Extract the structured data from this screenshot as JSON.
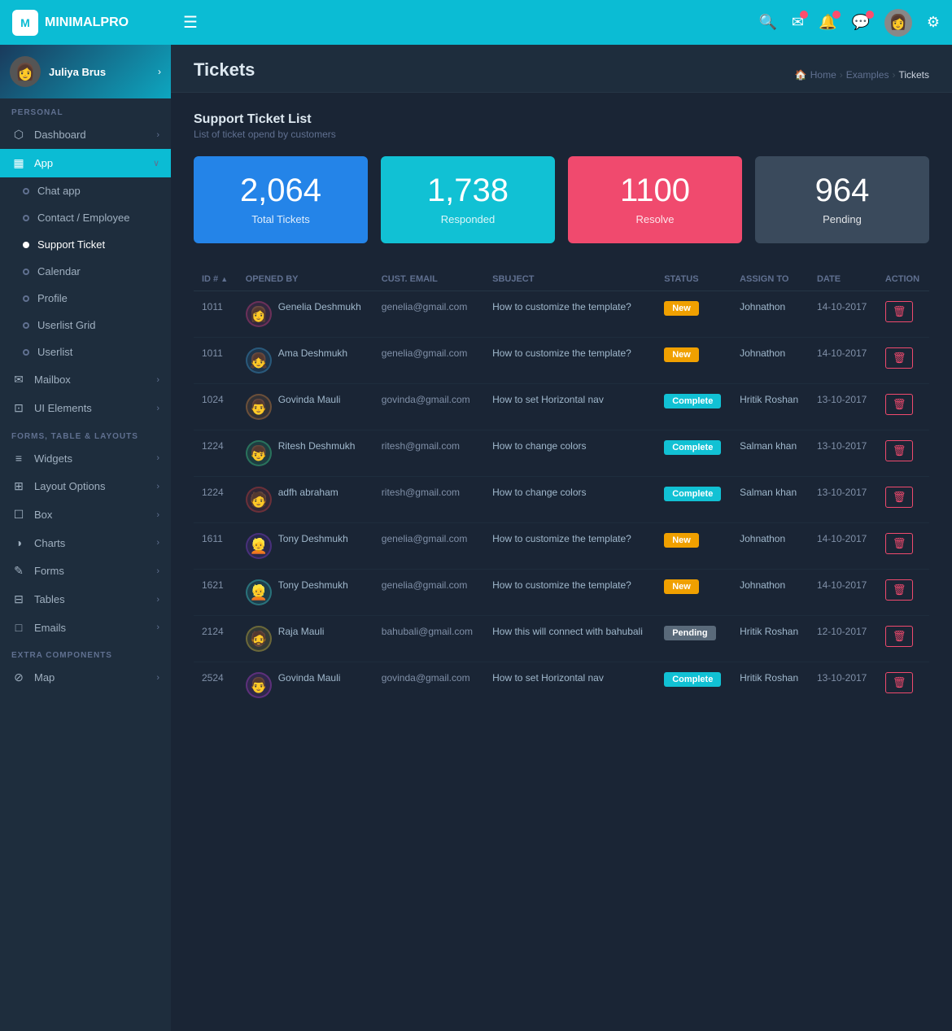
{
  "app": {
    "name": "MINIMALPRO"
  },
  "topnav": {
    "hamburger_label": "☰"
  },
  "user": {
    "name": "Juliya Brus"
  },
  "sidebar": {
    "personal_label": "PERSONAL",
    "forms_label": "FORMS, TABLE & LAYOUTS",
    "extra_label": "EXTRA COMPONENTS",
    "items": [
      {
        "id": "dashboard",
        "label": "Dashboard",
        "icon": "⬡",
        "has_arrow": true
      },
      {
        "id": "app",
        "label": "App",
        "icon": "▦",
        "has_arrow": true,
        "active": true
      },
      {
        "id": "chat-app",
        "label": "Chat app",
        "is_sub": true
      },
      {
        "id": "contact-employee",
        "label": "Contact / Employee",
        "is_sub": true
      },
      {
        "id": "support-ticket",
        "label": "Support Ticket",
        "is_sub": true,
        "active_sub": true
      },
      {
        "id": "calendar",
        "label": "Calendar",
        "is_sub": true
      },
      {
        "id": "profile",
        "label": "Profile",
        "is_sub": true
      },
      {
        "id": "userlist-grid",
        "label": "Userlist Grid",
        "is_sub": true
      },
      {
        "id": "userlist",
        "label": "Userlist",
        "is_sub": true
      },
      {
        "id": "mailbox",
        "label": "Mailbox",
        "icon": "✉",
        "has_arrow": true
      },
      {
        "id": "ui-elements",
        "label": "UI Elements",
        "icon": "⊡",
        "has_arrow": true
      },
      {
        "id": "widgets",
        "label": "Widgets",
        "icon": "≡",
        "has_arrow": true
      },
      {
        "id": "layout-options",
        "label": "Layout Options",
        "icon": "⊞",
        "has_arrow": true
      },
      {
        "id": "box",
        "label": "Box",
        "icon": "☐",
        "has_arrow": true
      },
      {
        "id": "charts",
        "label": "Charts",
        "icon": "◑",
        "has_arrow": true
      },
      {
        "id": "forms",
        "label": "Forms",
        "icon": "✎",
        "has_arrow": true
      },
      {
        "id": "tables",
        "label": "Tables",
        "icon": "⊟",
        "has_arrow": true
      },
      {
        "id": "emails",
        "label": "Emails",
        "icon": "□",
        "has_arrow": true
      },
      {
        "id": "map",
        "label": "Map",
        "icon": "⊘",
        "has_arrow": true
      }
    ]
  },
  "page": {
    "title": "Tickets",
    "breadcrumb": [
      "Home",
      "Examples",
      "Tickets"
    ],
    "section_title": "Support Ticket List",
    "section_sub": "List of ticket opend by customers"
  },
  "stats": [
    {
      "id": "total",
      "number": "2,064",
      "label": "Total Tickets",
      "color": "blue"
    },
    {
      "id": "responded",
      "number": "1,738",
      "label": "Responded",
      "color": "cyan"
    },
    {
      "id": "resolve",
      "number": "1100",
      "label": "Resolve",
      "color": "red"
    },
    {
      "id": "pending",
      "number": "964",
      "label": "Pending",
      "color": "gray"
    }
  ],
  "table": {
    "columns": [
      "ID #",
      "Opened By",
      "Cust. Email",
      "Sbuject",
      "Status",
      "Assign to",
      "Date",
      "Action"
    ],
    "rows": [
      {
        "id": "1011",
        "opened_by": "Genelia Deshmukh",
        "avatar": "👩",
        "email": "genelia@gmail.com",
        "subject": "How to customize the template?",
        "status": "New",
        "assign_to": "Johnathon",
        "date": "14-10-2017"
      },
      {
        "id": "1011",
        "opened_by": "Ama Deshmukh",
        "avatar": "👧",
        "email": "genelia@gmail.com",
        "subject": "How to customize the template?",
        "status": "New",
        "assign_to": "Johnathon",
        "date": "14-10-2017"
      },
      {
        "id": "1024",
        "opened_by": "Govinda Mauli",
        "avatar": "👨",
        "email": "govinda@gmail.com",
        "subject": "How to set Horizontal nav",
        "status": "Complete",
        "assign_to": "Hritik Roshan",
        "date": "13-10-2017"
      },
      {
        "id": "1224",
        "opened_by": "Ritesh Deshmukh",
        "avatar": "👦",
        "email": "ritesh@gmail.com",
        "subject": "How to change colors",
        "status": "Complete",
        "assign_to": "Salman khan",
        "date": "13-10-2017"
      },
      {
        "id": "1224",
        "opened_by": "adfh abraham",
        "avatar": "🧑",
        "email": "ritesh@gmail.com",
        "subject": "How to change colors",
        "status": "Complete",
        "assign_to": "Salman khan",
        "date": "13-10-2017"
      },
      {
        "id": "1611",
        "opened_by": "Tony Deshmukh",
        "avatar": "👱",
        "email": "genelia@gmail.com",
        "subject": "How to customize the template?",
        "status": "New",
        "assign_to": "Johnathon",
        "date": "14-10-2017"
      },
      {
        "id": "1621",
        "opened_by": "Tony Deshmukh",
        "avatar": "👱",
        "email": "genelia@gmail.com",
        "subject": "How to customize the template?",
        "status": "New",
        "assign_to": "Johnathon",
        "date": "14-10-2017"
      },
      {
        "id": "2124",
        "opened_by": "Raja Mauli",
        "avatar": "🧔",
        "email": "bahubali@gmail.com",
        "subject": "How this will connect with bahubali",
        "status": "Pending",
        "assign_to": "Hritik Roshan",
        "date": "12-10-2017"
      },
      {
        "id": "2524",
        "opened_by": "Govinda Mauli",
        "avatar": "👨",
        "email": "govinda@gmail.com",
        "subject": "How to set Horizontal nav",
        "status": "Complete",
        "assign_to": "Hritik Roshan",
        "date": "13-10-2017"
      }
    ]
  },
  "icons": {
    "search": "🔍",
    "mail": "✉",
    "bell": "🔔",
    "chat": "💬",
    "gear": "⚙",
    "delete": "🗑"
  }
}
